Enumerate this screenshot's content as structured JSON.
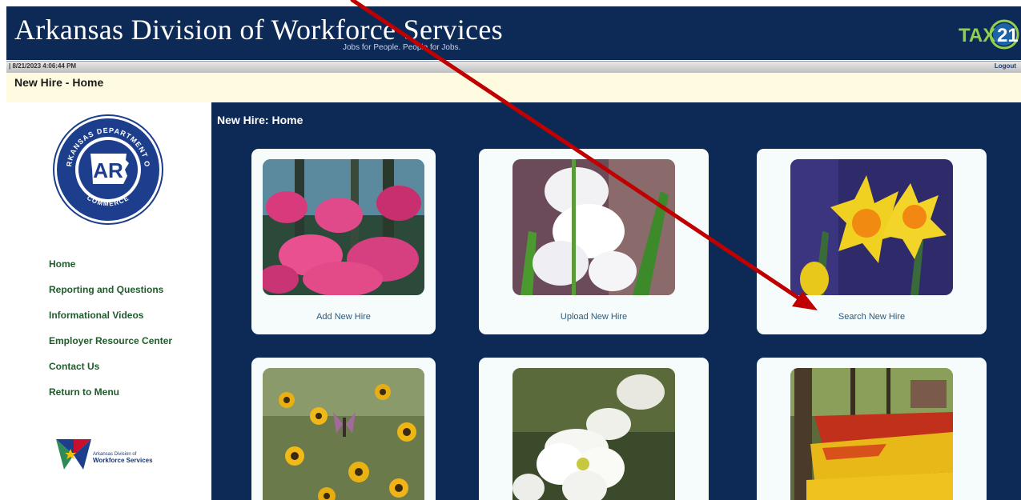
{
  "header": {
    "site_title": "Arkansas Division of Workforce Services",
    "tagline": "Jobs for People. People for Jobs.",
    "tax_logo_text": "TAX 21",
    "tax_logo_icon": "tax21-logo-icon"
  },
  "status": {
    "datetime": "| 8/21/2023 4:06:44 PM",
    "logout_label": "Logout"
  },
  "page": {
    "title": "New Hire - Home"
  },
  "sidebar": {
    "seal_icon": "arkansas-department-of-commerce-seal",
    "seal_text_top": "ARKANSAS DEPARTMENT OF",
    "seal_text_bottom": "COMMERCE",
    "seal_center": "AR",
    "nav_items": [
      {
        "label": "Home"
      },
      {
        "label": "Reporting and Questions"
      },
      {
        "label": "Informational Videos"
      },
      {
        "label": "Employer Resource Center"
      },
      {
        "label": "Contact Us"
      },
      {
        "label": "Return to Menu"
      }
    ],
    "footer_logo": {
      "icon": "workforce-services-logo-icon",
      "line1": "Arkansas Division of",
      "line2": "Workforce Services"
    }
  },
  "main": {
    "heading": "New Hire: Home",
    "cards": [
      {
        "label": "Add New Hire",
        "photo": "pink-azalea-photo"
      },
      {
        "label": "Upload New Hire",
        "photo": "white-hyacinth-photo"
      },
      {
        "label": "Search New Hire",
        "photo": "yellow-daffodil-photo"
      },
      {
        "label": "",
        "photo": "black-eyed-susan-butterfly-photo"
      },
      {
        "label": "",
        "photo": "white-dogwood-photo"
      },
      {
        "label": "",
        "photo": "tulip-garden-photo"
      }
    ]
  },
  "annotation": {
    "arrow_icon": "red-arrow-icon",
    "arrow_color": "#c00000"
  },
  "colors": {
    "navy": "#0d2a57",
    "nav_green": "#1f5b2b",
    "title_bar": "#fefbe0",
    "card_bg": "#f6fbfb"
  }
}
